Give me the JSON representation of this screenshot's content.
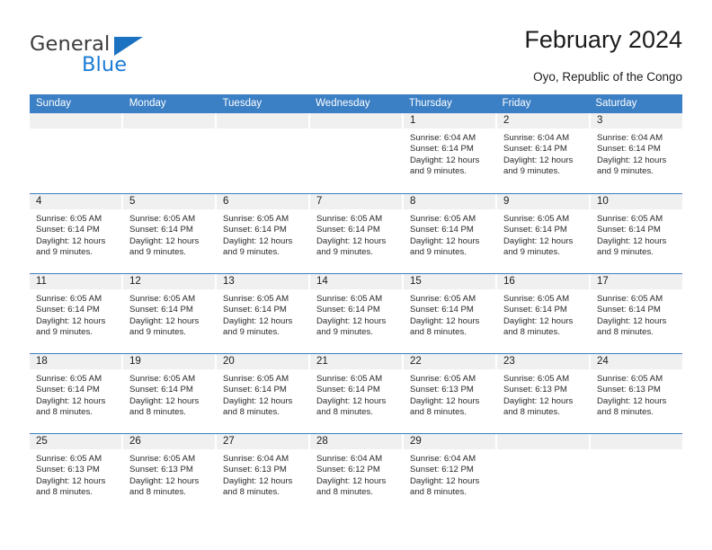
{
  "brand": {
    "name_part1": "General",
    "name_part2": "Blue",
    "accent_color": "#1a7bd4",
    "triangle_color": "#1a72c0"
  },
  "header": {
    "title": "February 2024",
    "subtitle": "Oyo, Republic of the Congo",
    "header_bg_color": "#3b7fc4"
  },
  "weekdays": [
    "Sunday",
    "Monday",
    "Tuesday",
    "Wednesday",
    "Thursday",
    "Friday",
    "Saturday"
  ],
  "weeks": [
    [
      {
        "day": "",
        "sunrise": "",
        "sunset": "",
        "daylight1": "",
        "daylight2": ""
      },
      {
        "day": "",
        "sunrise": "",
        "sunset": "",
        "daylight1": "",
        "daylight2": ""
      },
      {
        "day": "",
        "sunrise": "",
        "sunset": "",
        "daylight1": "",
        "daylight2": ""
      },
      {
        "day": "",
        "sunrise": "",
        "sunset": "",
        "daylight1": "",
        "daylight2": ""
      },
      {
        "day": "1",
        "sunrise": "Sunrise: 6:04 AM",
        "sunset": "Sunset: 6:14 PM",
        "daylight1": "Daylight: 12 hours",
        "daylight2": "and 9 minutes."
      },
      {
        "day": "2",
        "sunrise": "Sunrise: 6:04 AM",
        "sunset": "Sunset: 6:14 PM",
        "daylight1": "Daylight: 12 hours",
        "daylight2": "and 9 minutes."
      },
      {
        "day": "3",
        "sunrise": "Sunrise: 6:04 AM",
        "sunset": "Sunset: 6:14 PM",
        "daylight1": "Daylight: 12 hours",
        "daylight2": "and 9 minutes."
      }
    ],
    [
      {
        "day": "4",
        "sunrise": "Sunrise: 6:05 AM",
        "sunset": "Sunset: 6:14 PM",
        "daylight1": "Daylight: 12 hours",
        "daylight2": "and 9 minutes."
      },
      {
        "day": "5",
        "sunrise": "Sunrise: 6:05 AM",
        "sunset": "Sunset: 6:14 PM",
        "daylight1": "Daylight: 12 hours",
        "daylight2": "and 9 minutes."
      },
      {
        "day": "6",
        "sunrise": "Sunrise: 6:05 AM",
        "sunset": "Sunset: 6:14 PM",
        "daylight1": "Daylight: 12 hours",
        "daylight2": "and 9 minutes."
      },
      {
        "day": "7",
        "sunrise": "Sunrise: 6:05 AM",
        "sunset": "Sunset: 6:14 PM",
        "daylight1": "Daylight: 12 hours",
        "daylight2": "and 9 minutes."
      },
      {
        "day": "8",
        "sunrise": "Sunrise: 6:05 AM",
        "sunset": "Sunset: 6:14 PM",
        "daylight1": "Daylight: 12 hours",
        "daylight2": "and 9 minutes."
      },
      {
        "day": "9",
        "sunrise": "Sunrise: 6:05 AM",
        "sunset": "Sunset: 6:14 PM",
        "daylight1": "Daylight: 12 hours",
        "daylight2": "and 9 minutes."
      },
      {
        "day": "10",
        "sunrise": "Sunrise: 6:05 AM",
        "sunset": "Sunset: 6:14 PM",
        "daylight1": "Daylight: 12 hours",
        "daylight2": "and 9 minutes."
      }
    ],
    [
      {
        "day": "11",
        "sunrise": "Sunrise: 6:05 AM",
        "sunset": "Sunset: 6:14 PM",
        "daylight1": "Daylight: 12 hours",
        "daylight2": "and 9 minutes."
      },
      {
        "day": "12",
        "sunrise": "Sunrise: 6:05 AM",
        "sunset": "Sunset: 6:14 PM",
        "daylight1": "Daylight: 12 hours",
        "daylight2": "and 9 minutes."
      },
      {
        "day": "13",
        "sunrise": "Sunrise: 6:05 AM",
        "sunset": "Sunset: 6:14 PM",
        "daylight1": "Daylight: 12 hours",
        "daylight2": "and 9 minutes."
      },
      {
        "day": "14",
        "sunrise": "Sunrise: 6:05 AM",
        "sunset": "Sunset: 6:14 PM",
        "daylight1": "Daylight: 12 hours",
        "daylight2": "and 9 minutes."
      },
      {
        "day": "15",
        "sunrise": "Sunrise: 6:05 AM",
        "sunset": "Sunset: 6:14 PM",
        "daylight1": "Daylight: 12 hours",
        "daylight2": "and 8 minutes."
      },
      {
        "day": "16",
        "sunrise": "Sunrise: 6:05 AM",
        "sunset": "Sunset: 6:14 PM",
        "daylight1": "Daylight: 12 hours",
        "daylight2": "and 8 minutes."
      },
      {
        "day": "17",
        "sunrise": "Sunrise: 6:05 AM",
        "sunset": "Sunset: 6:14 PM",
        "daylight1": "Daylight: 12 hours",
        "daylight2": "and 8 minutes."
      }
    ],
    [
      {
        "day": "18",
        "sunrise": "Sunrise: 6:05 AM",
        "sunset": "Sunset: 6:14 PM",
        "daylight1": "Daylight: 12 hours",
        "daylight2": "and 8 minutes."
      },
      {
        "day": "19",
        "sunrise": "Sunrise: 6:05 AM",
        "sunset": "Sunset: 6:14 PM",
        "daylight1": "Daylight: 12 hours",
        "daylight2": "and 8 minutes."
      },
      {
        "day": "20",
        "sunrise": "Sunrise: 6:05 AM",
        "sunset": "Sunset: 6:14 PM",
        "daylight1": "Daylight: 12 hours",
        "daylight2": "and 8 minutes."
      },
      {
        "day": "21",
        "sunrise": "Sunrise: 6:05 AM",
        "sunset": "Sunset: 6:14 PM",
        "daylight1": "Daylight: 12 hours",
        "daylight2": "and 8 minutes."
      },
      {
        "day": "22",
        "sunrise": "Sunrise: 6:05 AM",
        "sunset": "Sunset: 6:13 PM",
        "daylight1": "Daylight: 12 hours",
        "daylight2": "and 8 minutes."
      },
      {
        "day": "23",
        "sunrise": "Sunrise: 6:05 AM",
        "sunset": "Sunset: 6:13 PM",
        "daylight1": "Daylight: 12 hours",
        "daylight2": "and 8 minutes."
      },
      {
        "day": "24",
        "sunrise": "Sunrise: 6:05 AM",
        "sunset": "Sunset: 6:13 PM",
        "daylight1": "Daylight: 12 hours",
        "daylight2": "and 8 minutes."
      }
    ],
    [
      {
        "day": "25",
        "sunrise": "Sunrise: 6:05 AM",
        "sunset": "Sunset: 6:13 PM",
        "daylight1": "Daylight: 12 hours",
        "daylight2": "and 8 minutes."
      },
      {
        "day": "26",
        "sunrise": "Sunrise: 6:05 AM",
        "sunset": "Sunset: 6:13 PM",
        "daylight1": "Daylight: 12 hours",
        "daylight2": "and 8 minutes."
      },
      {
        "day": "27",
        "sunrise": "Sunrise: 6:04 AM",
        "sunset": "Sunset: 6:13 PM",
        "daylight1": "Daylight: 12 hours",
        "daylight2": "and 8 minutes."
      },
      {
        "day": "28",
        "sunrise": "Sunrise: 6:04 AM",
        "sunset": "Sunset: 6:12 PM",
        "daylight1": "Daylight: 12 hours",
        "daylight2": "and 8 minutes."
      },
      {
        "day": "29",
        "sunrise": "Sunrise: 6:04 AM",
        "sunset": "Sunset: 6:12 PM",
        "daylight1": "Daylight: 12 hours",
        "daylight2": "and 8 minutes."
      },
      {
        "day": "",
        "sunrise": "",
        "sunset": "",
        "daylight1": "",
        "daylight2": ""
      },
      {
        "day": "",
        "sunrise": "",
        "sunset": "",
        "daylight1": "",
        "daylight2": ""
      }
    ]
  ]
}
